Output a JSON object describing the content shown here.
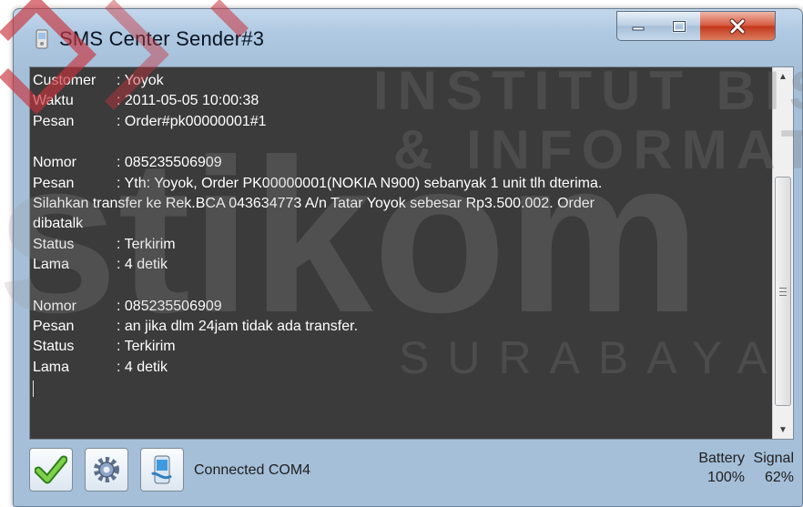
{
  "window": {
    "title": "SMS Center Sender#3",
    "controls": {
      "minimize": "minimize",
      "maximize": "maximize",
      "close": "close"
    }
  },
  "log": {
    "entry1": {
      "customer_label": "Customer",
      "customer_value": ": Yoyok",
      "waktu_label": "Waktu",
      "waktu_value": ": 2011-05-05 10:00:38",
      "pesan_label": "Pesan",
      "pesan_value": ": Order#pk00000001#1"
    },
    "entry2": {
      "nomor_label": "Nomor",
      "nomor_value": ": 085235506909",
      "pesan_label": "Pesan",
      "pesan_value": ": Yth: Yoyok, Order PK00000001(NOKIA N900) sebanyak 1 unit tlh dterima.",
      "pesan_line2": "Silahkan transfer ke Rek.BCA 043634773 A/n Tatar Yoyok sebesar Rp3.500.002. Order",
      "pesan_line3": "dibatalk",
      "status_label": "Status",
      "status_value": ": Terkirim",
      "lama_label": "Lama",
      "lama_value": ": 4 detik"
    },
    "entry3": {
      "nomor_label": "Nomor",
      "nomor_value": ": 085235506909",
      "pesan_label": "Pesan",
      "pesan_value": ": an jika dlm 24jam tidak ada transfer.",
      "status_label": "Status",
      "status_value": ": Terkirim",
      "lama_label": "Lama",
      "lama_value": ": 4 detik"
    }
  },
  "statusbar": {
    "connection": "Connected COM4",
    "battery_label": "Battery",
    "battery_value": "100%",
    "signal_label": "Signal",
    "signal_value": "62%"
  },
  "icons": {
    "send": "check-icon",
    "settings": "gear-icon",
    "phone": "phone-icon"
  },
  "watermark": {
    "line1": "INSTITUT BISNIS",
    "line2": "& INFORMATIKA",
    "brand": "stikom",
    "city": "SURABAYA"
  },
  "colors": {
    "log_background": "#3b3b3b",
    "log_text": "#ffffff",
    "titlebar": "#aec8e2",
    "close_button": "#c3361b",
    "watermark_red": "#c8323c"
  }
}
